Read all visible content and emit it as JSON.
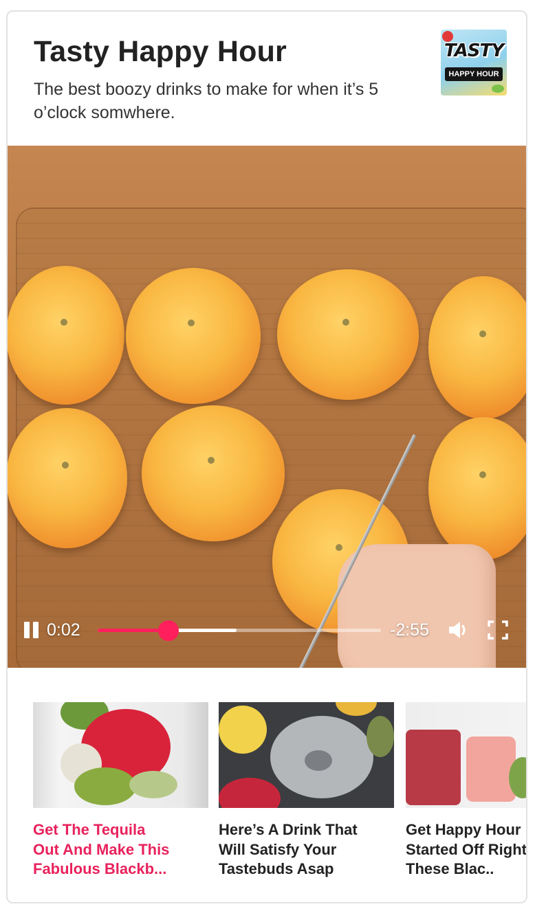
{
  "card": {
    "title": "Tasty Happy Hour",
    "description": "The best boozy drinks to make for when it’s 5 o’clock somwhere.",
    "logo": {
      "line1": "TASTY",
      "line2": "HAPPY HOUR"
    }
  },
  "player": {
    "state": "playing",
    "elapsed": "0:02",
    "remaining": "-2:55",
    "played_fraction": 0.25,
    "buffered_fraction": 0.49,
    "accent_color": "#ff1f5c"
  },
  "related": [
    {
      "title": "Get The Tequila\nOut And Make This\nFabulous Blackb...",
      "active": true
    },
    {
      "title": "Here’s A Drink That\nWill Satisfy Your\nTastebuds Asap",
      "active": false
    },
    {
      "title": "Get Happy Hour\nStarted Off Right\nThese Blac..",
      "active": false
    }
  ],
  "colors": {
    "active_title": "#e8225c",
    "text": "#222222",
    "border": "#e2e2e2"
  }
}
